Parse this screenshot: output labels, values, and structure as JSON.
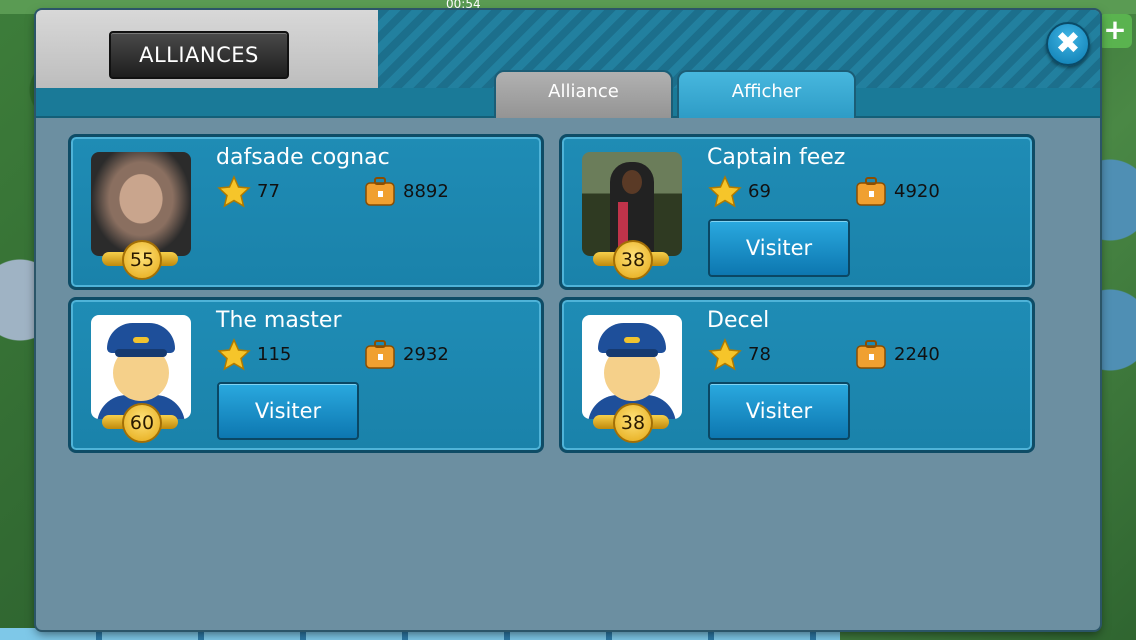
{
  "status_bar": {
    "time": "00:54"
  },
  "dialog": {
    "title": "ALLIANCES",
    "close_label": "✖",
    "tabs": [
      {
        "label": "Alliance",
        "active": false
      },
      {
        "label": "Afficher",
        "active": true
      }
    ]
  },
  "members": [
    {
      "name": "dafsade cognac",
      "level": "55",
      "stars": "77",
      "cargo": "8892",
      "avatar": "photo",
      "visit_label": ""
    },
    {
      "name": "Captain feez",
      "level": "38",
      "stars": "69",
      "cargo": "4920",
      "avatar": "photo",
      "visit_label": "Visiter"
    },
    {
      "name": "The master",
      "level": "60",
      "stars": "115",
      "cargo": "2932",
      "avatar": "pilot",
      "visit_label": "Visiter"
    },
    {
      "name": "Decel",
      "level": "38",
      "stars": "78",
      "cargo": "2240",
      "avatar": "pilot",
      "visit_label": "Visiter"
    }
  ],
  "icons": {
    "star": "star-icon",
    "cargo": "suitcase-icon",
    "close": "close-icon"
  },
  "colors": {
    "panel": "#6c8fa1",
    "card": "#1f8cb5",
    "button": "#1a8fc6",
    "tab_active": "#3aa9d2",
    "tab_inactive": "#a5a5a5"
  }
}
